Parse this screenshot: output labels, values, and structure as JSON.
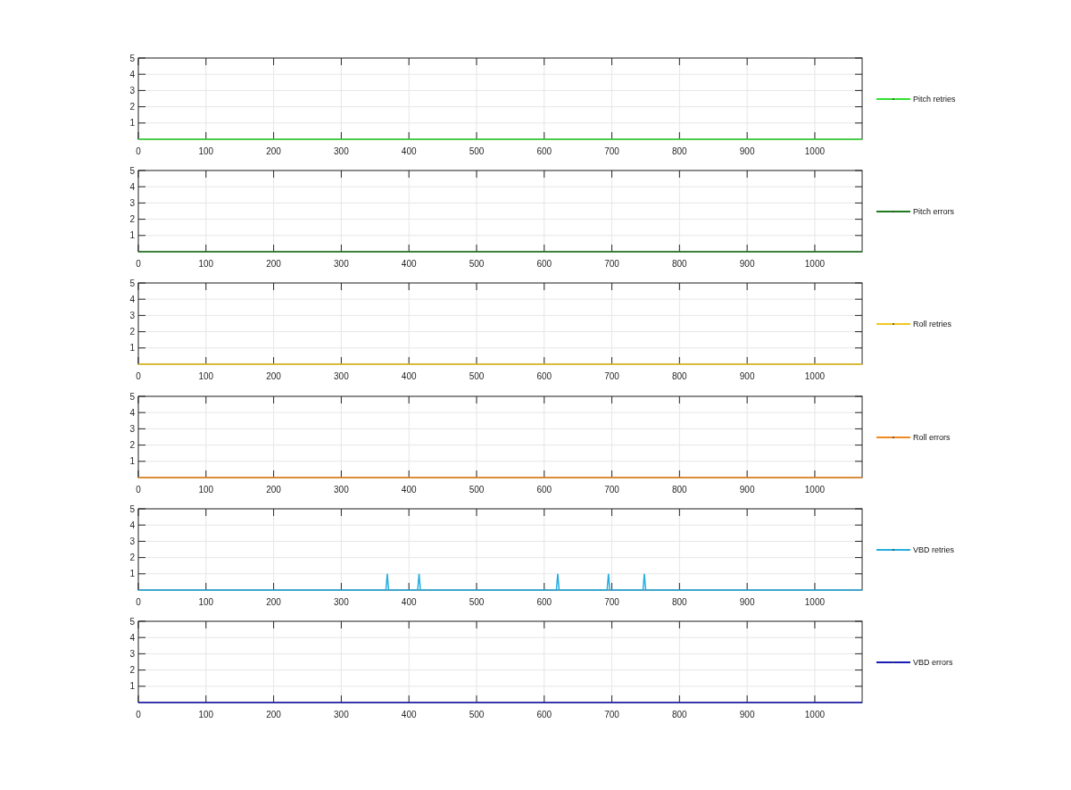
{
  "charts": [
    {
      "chart_data": {
        "type": "line",
        "x": [
          0,
          1070
        ],
        "series": [
          {
            "name": "Pitch retries",
            "color": "#33e033",
            "values": [
              0,
              0
            ]
          }
        ],
        "xlim": [
          0,
          1070
        ],
        "ylim": [
          0,
          5
        ],
        "xticks": [
          0,
          100,
          200,
          300,
          400,
          500,
          600,
          700,
          800,
          900,
          1000
        ],
        "yticks": [
          1,
          2,
          3,
          4,
          5
        ],
        "grid": true
      }
    },
    {
      "chart_data": {
        "type": "line",
        "x": [
          0,
          1070
        ],
        "series": [
          {
            "name": "Pitch errors",
            "color": "#1e7a1e",
            "values": [
              0,
              0
            ]
          }
        ],
        "xlim": [
          0,
          1070
        ],
        "ylim": [
          0,
          5
        ],
        "xticks": [
          0,
          100,
          200,
          300,
          400,
          500,
          600,
          700,
          800,
          900,
          1000
        ],
        "yticks": [
          1,
          2,
          3,
          4,
          5
        ],
        "grid": true
      }
    },
    {
      "chart_data": {
        "type": "line",
        "x": [
          0,
          1070
        ],
        "series": [
          {
            "name": "Roll retries",
            "color": "#f2c81e",
            "values": [
              0,
              0
            ]
          }
        ],
        "xlim": [
          0,
          1070
        ],
        "ylim": [
          0,
          5
        ],
        "xticks": [
          0,
          100,
          200,
          300,
          400,
          500,
          600,
          700,
          800,
          900,
          1000
        ],
        "yticks": [
          1,
          2,
          3,
          4,
          5
        ],
        "grid": true
      }
    },
    {
      "chart_data": {
        "type": "line",
        "x": [
          0,
          1070
        ],
        "series": [
          {
            "name": "Roll errors",
            "color": "#f08a1e",
            "values": [
              0,
              0
            ]
          }
        ],
        "xlim": [
          0,
          1070
        ],
        "ylim": [
          0,
          5
        ],
        "xticks": [
          0,
          100,
          200,
          300,
          400,
          500,
          600,
          700,
          800,
          900,
          1000
        ],
        "yticks": [
          1,
          2,
          3,
          4,
          5
        ],
        "grid": true
      }
    },
    {
      "chart_data": {
        "type": "line",
        "x": [
          0,
          366,
          368,
          370,
          413,
          415,
          417,
          618,
          620,
          622,
          693,
          695,
          697,
          746,
          748,
          750,
          1070
        ],
        "series": [
          {
            "name": "VBD retries",
            "color": "#22aee0",
            "values": [
              0,
              0,
              1,
              0,
              0,
              1,
              0,
              0,
              1,
              0,
              0,
              1,
              0,
              0,
              1,
              0,
              0
            ]
          }
        ],
        "xlim": [
          0,
          1070
        ],
        "ylim": [
          0,
          5
        ],
        "xticks": [
          0,
          100,
          200,
          300,
          400,
          500,
          600,
          700,
          800,
          900,
          1000
        ],
        "yticks": [
          1,
          2,
          3,
          4,
          5
        ],
        "grid": true
      }
    },
    {
      "chart_data": {
        "type": "line",
        "x": [
          0,
          1070
        ],
        "series": [
          {
            "name": "VBD errors",
            "color": "#1a1ab4",
            "values": [
              0,
              0
            ]
          }
        ],
        "xlim": [
          0,
          1070
        ],
        "ylim": [
          0,
          5
        ],
        "xticks": [
          0,
          100,
          200,
          300,
          400,
          500,
          600,
          700,
          800,
          900,
          1000
        ],
        "yticks": [
          1,
          2,
          3,
          4,
          5
        ],
        "grid": true
      }
    }
  ]
}
